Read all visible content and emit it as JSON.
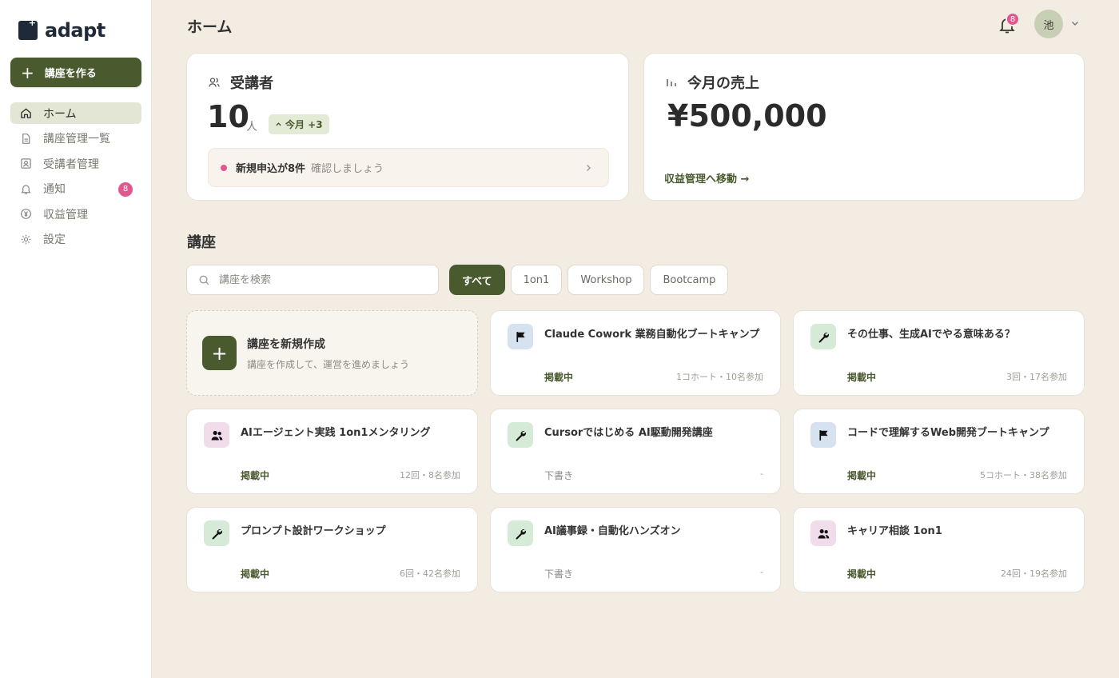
{
  "app": {
    "logo_text": "adapt"
  },
  "sidebar": {
    "create_label": "講座を作る",
    "items": [
      {
        "label": "ホーム",
        "icon": "home-icon",
        "active": true
      },
      {
        "label": "講座管理一覧",
        "icon": "document-icon"
      },
      {
        "label": "受講者管理",
        "icon": "user-card-icon"
      },
      {
        "label": "通知",
        "icon": "bell-icon",
        "badge": "8"
      },
      {
        "label": "収益管理",
        "icon": "yen-icon"
      },
      {
        "label": "設定",
        "icon": "gear-icon"
      }
    ]
  },
  "header": {
    "title": "ホーム",
    "notification_count": "8",
    "avatar_initial": "池"
  },
  "stats": {
    "students": {
      "title": "受講者",
      "value": "10",
      "unit": "人",
      "delta": "今月 +3",
      "alert_strong": "新規申込が8件",
      "alert_soft": "確認しましょう"
    },
    "sales": {
      "title": "今月の売上",
      "value": "¥500,000",
      "link": "収益管理へ移動 →"
    }
  },
  "courses": {
    "section_title": "講座",
    "search_placeholder": "講座を検索",
    "filters": [
      "すべて",
      "1on1",
      "Workshop",
      "Bootcamp"
    ],
    "active_filter": "すべて",
    "new_card": {
      "title": "講座を新規作成",
      "subtitle": "講座を作成して、運営を進めましょう"
    },
    "items": [
      {
        "name": "Claude Cowork 業務自動化ブートキャンプ",
        "status": "掲載中",
        "meta": "1コホート・10名参加",
        "icon": "flag-icon",
        "icon_bg": "#d6e2f0"
      },
      {
        "name": "その仕事、生成AIでやる意味ある？",
        "status": "掲載中",
        "meta": "3回・17名参加",
        "icon": "wrench-icon",
        "icon_bg": "#d5ebd8"
      },
      {
        "name": "AIエージェント実践 1on1メンタリング",
        "status": "掲載中",
        "meta": "12回・8名参加",
        "icon": "people-icon",
        "icon_bg": "#f1dcec"
      },
      {
        "name": "Cursorではじめる AI駆動開発講座",
        "status": "下書き",
        "meta": "-",
        "icon": "wrench-icon",
        "icon_bg": "#d5ebd8"
      },
      {
        "name": "コードで理解するWeb開発ブートキャンプ",
        "status": "掲載中",
        "meta": "5コホート・38名参加",
        "icon": "flag-icon",
        "icon_bg": "#d6e2f0"
      },
      {
        "name": "プロンプト設計ワークショップ",
        "status": "掲載中",
        "meta": "6回・42名参加",
        "icon": "wrench-icon",
        "icon_bg": "#d5ebd8"
      },
      {
        "name": "AI議事録・自動化ハンズオン",
        "status": "下書き",
        "meta": "-",
        "icon": "wrench-icon",
        "icon_bg": "#d5ebd8"
      },
      {
        "name": "キャリア相談 1on1",
        "status": "掲載中",
        "meta": "24回・19名参加",
        "icon": "people-icon",
        "icon_bg": "#f1dcec"
      }
    ]
  },
  "colors": {
    "accent": "#4a5a2f",
    "badge": "#e0588f",
    "background": "#f3ece3"
  }
}
